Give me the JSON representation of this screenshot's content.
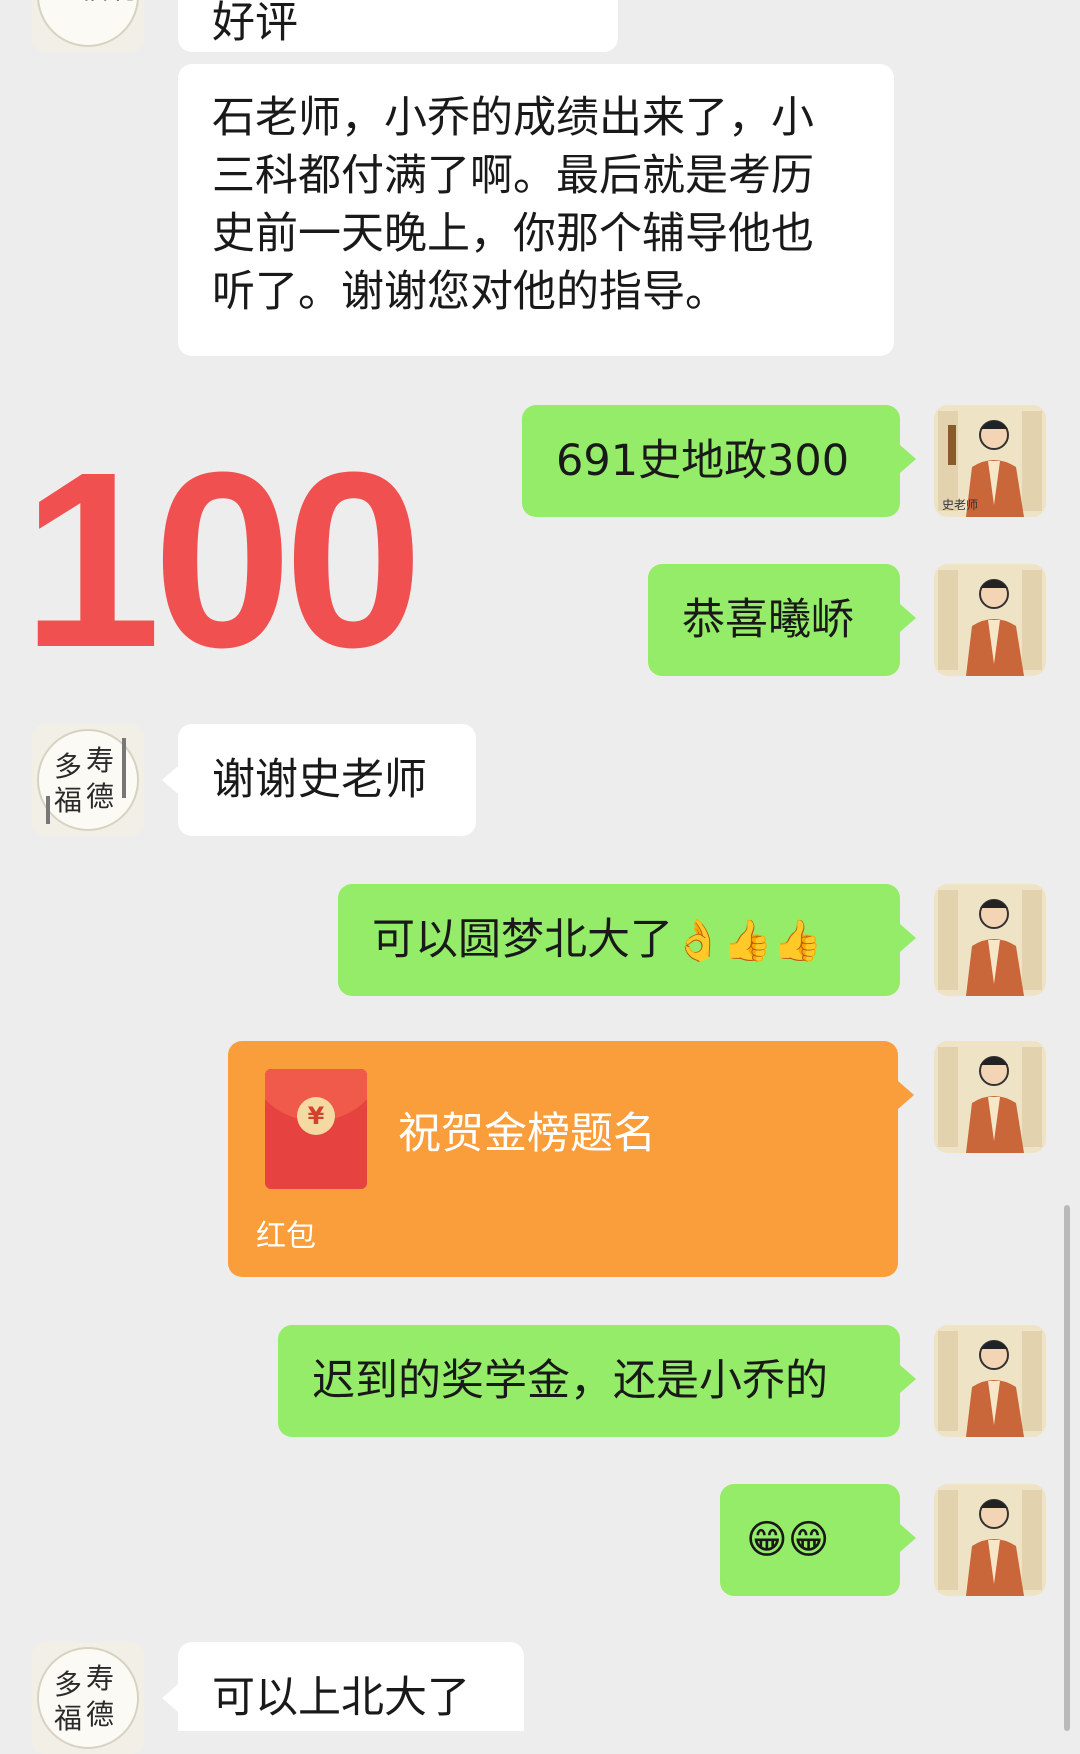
{
  "messages": [
    {
      "side": "left",
      "text": "好评"
    },
    {
      "side": "left",
      "text": "石老师，小乔的成绩出来了，小三科都付满了啊。最后就是考历史前一天晚上，你那个辅导他也听了。谢谢您对他的指导。",
      "lines": [
        "石老师，小乔的成绩出来了，小",
        "三科都付满了啊。最后就是考历",
        "史前一天晚上，你那个辅导他也",
        "听了。谢谢您对他的指导。"
      ]
    },
    {
      "side": "right",
      "text": "691史地政300"
    },
    {
      "side": "right",
      "text": "恭喜曦峤"
    },
    {
      "side": "left",
      "text": "谢谢史老师"
    },
    {
      "side": "right",
      "text": "可以圆梦北大了",
      "emojis": "👌👍👍"
    },
    {
      "side": "right",
      "type": "red-packet",
      "title": "祝贺金榜题名",
      "label": "红包",
      "coin": "¥"
    },
    {
      "side": "right",
      "text": "迟到的奖学金，还是小乔的"
    },
    {
      "side": "right",
      "emojis": "😁😁"
    },
    {
      "side": "left",
      "text": "可以上北大了"
    }
  ],
  "overlay": {
    "big_number": "100"
  },
  "avatars": {
    "left_calligraphy": [
      "多",
      "福",
      "寿",
      "德"
    ],
    "right_caption": "史老师"
  },
  "colors": {
    "background": "#ededed",
    "bubble_left": "#ffffff",
    "bubble_right": "#95ec69",
    "red_packet": "#fa9d3b",
    "big_number": "#f0504f"
  }
}
